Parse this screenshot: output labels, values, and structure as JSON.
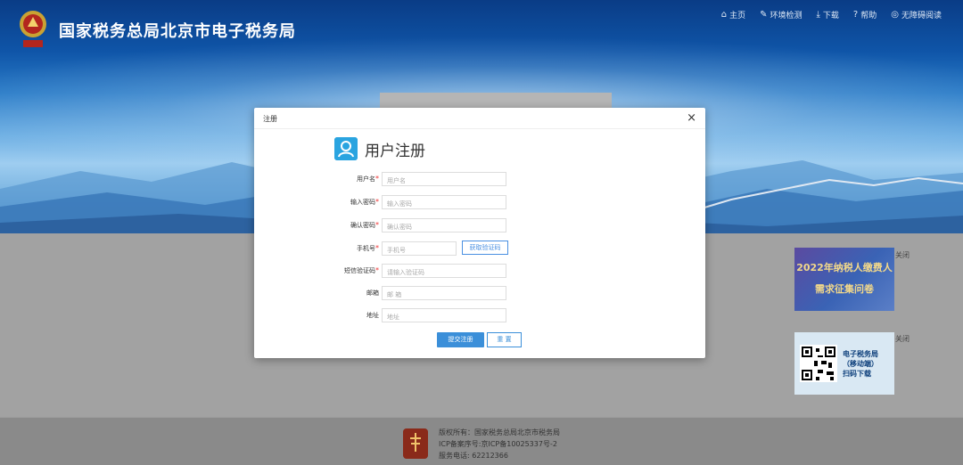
{
  "header": {
    "site_title": "国家税务总局北京市电子税务局",
    "nav": [
      {
        "icon": "home-icon",
        "glyph": "⌂",
        "label": "主页"
      },
      {
        "icon": "check-icon",
        "glyph": "✎",
        "label": "环境检测"
      },
      {
        "icon": "download-icon",
        "glyph": "⤓",
        "label": "下载"
      },
      {
        "icon": "help-icon",
        "glyph": "?",
        "label": "帮助"
      },
      {
        "icon": "eye-icon",
        "glyph": "◎",
        "label": "无障碍阅读"
      }
    ]
  },
  "modal": {
    "title": "注册",
    "close": "×",
    "heading": "用户注册",
    "fields": [
      {
        "label": "用户名",
        "required": "*",
        "placeholder": "用户名"
      },
      {
        "label": "输入密码",
        "required": "*",
        "placeholder": "输入密码"
      },
      {
        "label": "确认密码",
        "required": "*",
        "placeholder": "确认密码"
      },
      {
        "label": "手机号",
        "required": "*",
        "placeholder": "手机号"
      },
      {
        "label": "短信验证码",
        "required": "*",
        "placeholder": "请输入验证码"
      },
      {
        "label": "邮箱",
        "required": "",
        "placeholder": "邮 箱"
      },
      {
        "label": "地址",
        "required": "",
        "placeholder": "地址"
      }
    ],
    "get_code_button": "获取验证码",
    "submit_button": "提交注册",
    "reset_button": "重 置"
  },
  "side": {
    "ad_line1": "2022年纳税人缴费人",
    "ad_line2": "需求征集问卷",
    "close_label": "关闭",
    "qr_text_1": "电子税务局",
    "qr_text_2": "（移动端）",
    "qr_text_3": "扫码下载",
    "close_label2": "关闭"
  },
  "footer": {
    "line1": "版权所有：国家税务总局北京市税务局",
    "line2": "ICP备案序号:京ICP备10025337号-2",
    "line3": "服务电话: 62212366"
  }
}
